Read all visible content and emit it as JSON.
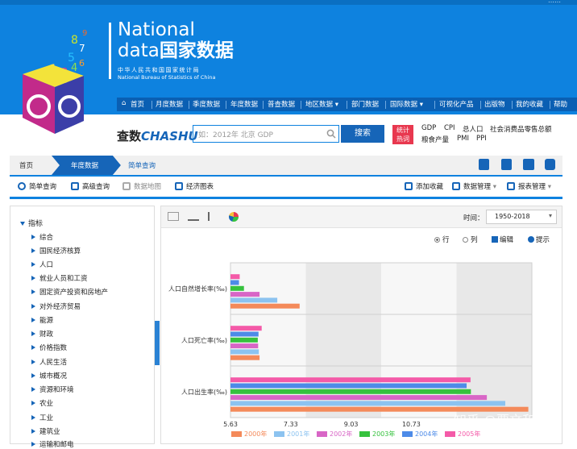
{
  "header": {
    "top_links": "……",
    "brand_line1": "National",
    "brand_line2_en": "data",
    "brand_line2_cn": "国家数据",
    "brand_org_cn": "中华人民共和国国家统计局",
    "brand_org_en": "National Bureau of Statistics of China",
    "nav": [
      "首页",
      "月度数据",
      "季度数据",
      "年度数据",
      "普查数据",
      "地区数据",
      "部门数据",
      "国际数据",
      "可视化产品",
      "出版物",
      "我的收藏",
      "帮助"
    ]
  },
  "search": {
    "logo_cn": "查数",
    "logo_en": "CHASHU",
    "placeholder": "如：2012年 北京 GDP",
    "button": "搜索",
    "hot_badge_line1": "统计",
    "hot_badge_line2": "热词",
    "hot_row1": [
      "GDP",
      "CPI",
      "总人口",
      "社会消费品零售总额"
    ],
    "hot_row2": [
      "粮食产量",
      "PMI",
      "PPI"
    ]
  },
  "breadcrumb": [
    "首页",
    "年度数据",
    "简单查询"
  ],
  "toolbar": {
    "left": [
      "简单查询",
      "高级查询",
      "数据地图",
      "经济图表"
    ],
    "right": [
      "添加收藏",
      "数据管理",
      "报表管理"
    ]
  },
  "sidebar": {
    "root": "指标",
    "items": [
      "综合",
      "国民经济核算",
      "人口",
      "就业人员和工资",
      "固定资产投资和房地产",
      "对外经济贸易",
      "能源",
      "财政",
      "价格指数",
      "人民生活",
      "城市概况",
      "资源和环境",
      "农业",
      "工业",
      "建筑业",
      "运输和邮电"
    ]
  },
  "panel": {
    "time_label": "时间：",
    "time_value": "1950-2018",
    "orientation": [
      "行",
      "列"
    ],
    "edit": "编辑",
    "hint": "提示"
  },
  "watermark": "知乎 @贾文和",
  "chart_data": {
    "type": "bar",
    "orientation": "horizontal",
    "categories": [
      "人口自然增长率(‰)",
      "人口死亡率(‰)",
      "人口出生率(‰)"
    ],
    "series": [
      {
        "name": "2000年",
        "color": "#f48a5a",
        "values": [
          7.58,
          6.45,
          14.03
        ]
      },
      {
        "name": "2001年",
        "color": "#8cc3f0",
        "values": [
          6.95,
          6.43,
          13.38
        ]
      },
      {
        "name": "2002年",
        "color": "#d866c6",
        "values": [
          6.45,
          6.41,
          12.86
        ]
      },
      {
        "name": "2003年",
        "color": "#36c23e",
        "values": [
          6.01,
          6.4,
          12.41
        ]
      },
      {
        "name": "2004年",
        "color": "#4d8be8",
        "values": [
          5.87,
          6.42,
          12.29
        ]
      },
      {
        "name": "2005年",
        "color": "#f45aa8",
        "values": [
          5.89,
          6.51,
          12.4
        ]
      }
    ],
    "x_ticks": [
      "5.63",
      "7.33",
      "9.03",
      "10.73"
    ],
    "xlim": [
      5.63,
      14.13
    ],
    "grid": true,
    "legend": "bottom"
  }
}
